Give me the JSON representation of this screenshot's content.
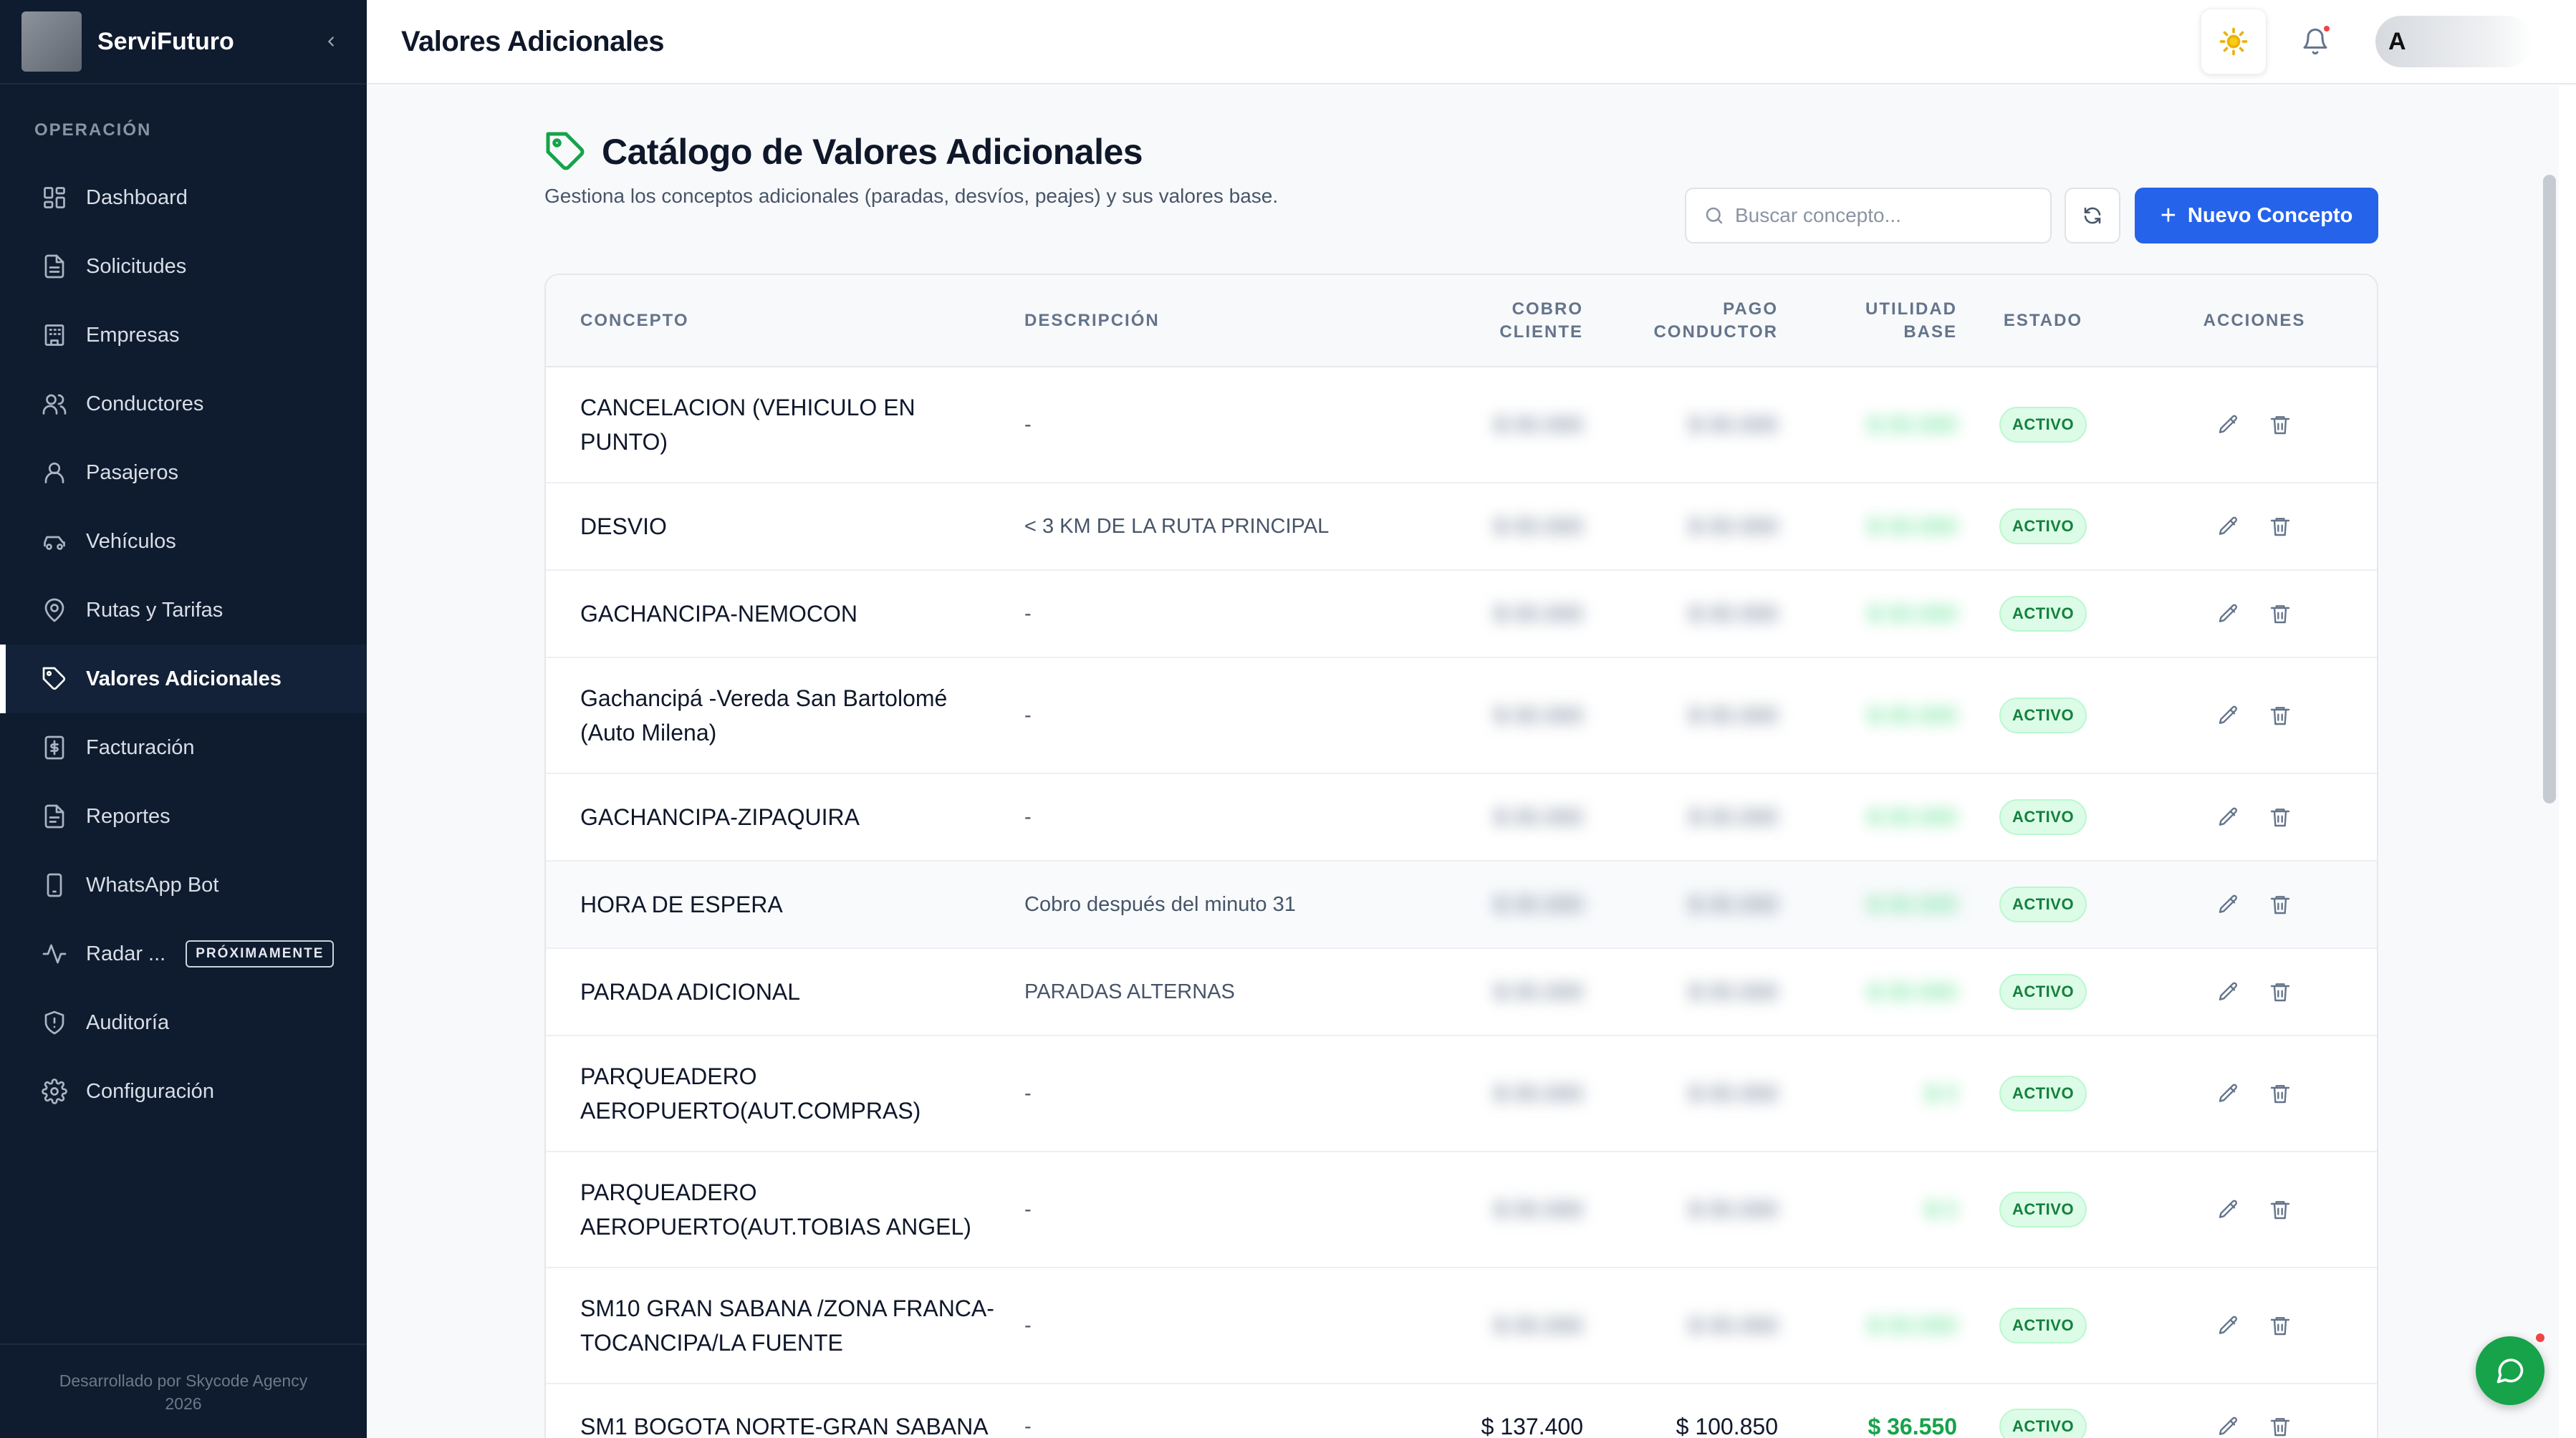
{
  "sidebar": {
    "brand": "ServiFuturo",
    "section_label": "OPERACIÓN",
    "items": [
      {
        "label": "Dashboard",
        "icon": "dashboard-icon"
      },
      {
        "label": "Solicitudes",
        "icon": "document-icon"
      },
      {
        "label": "Empresas",
        "icon": "building-icon"
      },
      {
        "label": "Conductores",
        "icon": "users-icon"
      },
      {
        "label": "Pasajeros",
        "icon": "user-icon"
      },
      {
        "label": "Vehículos",
        "icon": "car-icon"
      },
      {
        "label": "Rutas y Tarifas",
        "icon": "map-pin-icon"
      },
      {
        "label": "Valores Adicionales",
        "icon": "tag-icon",
        "active": true
      },
      {
        "label": "Facturación",
        "icon": "invoice-icon"
      },
      {
        "label": "Reportes",
        "icon": "report-icon"
      },
      {
        "label": "WhatsApp Bot",
        "icon": "phone-icon"
      },
      {
        "label": "Radar ...",
        "icon": "activity-icon",
        "badge": "PRÓXIMAMENTE"
      },
      {
        "label": "Auditoría",
        "icon": "shield-icon"
      },
      {
        "label": "Configuración",
        "icon": "gear-icon"
      }
    ],
    "footer_line1": "Desarrollado por Skycode Agency",
    "footer_line2": "2026"
  },
  "topbar": {
    "title": "Valores Adicionales",
    "avatar_initial": "A"
  },
  "page": {
    "title": "Catálogo de Valores Adicionales",
    "subtitle": "Gestiona los conceptos adicionales (paradas, desvíos, peajes) y sus valores base.",
    "search_placeholder": "Buscar concepto...",
    "new_button": "Nuevo Concepto"
  },
  "table": {
    "headers": {
      "concepto": "CONCEPTO",
      "descripcion": "DESCRIPCIÓN",
      "cobro_l1": "COBRO",
      "cobro_l2": "CLIENTE",
      "pago_l1": "PAGO",
      "pago_l2": "CONDUCTOR",
      "utilidad_l1": "UTILIDAD",
      "utilidad_l2": "BASE",
      "estado": "ESTADO",
      "acciones": "ACCIONES"
    },
    "rows": [
      {
        "concepto": "CANCELACION (VEHICULO EN PUNTO)",
        "descripcion": "-",
        "cobro": "$ 00.000",
        "pago": "$ 00.000",
        "utilidad": "$ 00.000",
        "estado": "ACTIVO",
        "blurred": true
      },
      {
        "concepto": "DESVIO",
        "descripcion": "< 3 KM DE LA RUTA PRINCIPAL",
        "cobro": "$ 00.000",
        "pago": "$ 00.000",
        "utilidad": "$ 00.000",
        "estado": "ACTIVO",
        "blurred": true
      },
      {
        "concepto": "GACHANCIPA-NEMOCON",
        "descripcion": "-",
        "cobro": "$ 00.000",
        "pago": "$ 00.000",
        "utilidad": "$ 00.000",
        "estado": "ACTIVO",
        "blurred": true
      },
      {
        "concepto": "Gachancipá -Vereda San Bartolomé (Auto Milena)",
        "descripcion": "-",
        "cobro": "$ 00.000",
        "pago": "$ 00.000",
        "utilidad": "$ 00.000",
        "estado": "ACTIVO",
        "blurred": true
      },
      {
        "concepto": "GACHANCIPA-ZIPAQUIRA",
        "descripcion": "-",
        "cobro": "$ 00.000",
        "pago": "$ 00.000",
        "utilidad": "$ 00.000",
        "estado": "ACTIVO",
        "blurred": true
      },
      {
        "concepto": "HORA DE ESPERA",
        "descripcion": "Cobro después del minuto 31",
        "cobro": "$ 00.000",
        "pago": "$ 00.000",
        "utilidad": "$ 00.000",
        "estado": "ACTIVO",
        "blurred": true,
        "highlight": true
      },
      {
        "concepto": "PARADA ADICIONAL",
        "descripcion": "PARADAS ALTERNAS",
        "cobro": "$ 00.000",
        "pago": "$ 00.000",
        "utilidad": "$ 00.000",
        "estado": "ACTIVO",
        "blurred": true
      },
      {
        "concepto": "PARQUEADERO AEROPUERTO(AUT.COMPRAS)",
        "descripcion": "-",
        "cobro": "$ 00.000",
        "pago": "$ 00.000",
        "utilidad": "$ 0",
        "estado": "ACTIVO",
        "blurred": true
      },
      {
        "concepto": "PARQUEADERO AEROPUERTO(AUT.TOBIAS ANGEL)",
        "descripcion": "-",
        "cobro": "$ 00.000",
        "pago": "$ 00.000",
        "utilidad": "$ 0",
        "estado": "ACTIVO",
        "blurred": true
      },
      {
        "concepto": "SM10 GRAN SABANA /ZONA FRANCA-TOCANCIPA/LA FUENTE",
        "descripcion": "-",
        "cobro": "$ 00.000",
        "pago": "$ 00.000",
        "utilidad": "$ 00.000",
        "estado": "ACTIVO",
        "blurred": true
      },
      {
        "concepto": "SM1 BOGOTA NORTE-GRAN SABANA",
        "descripcion": "-",
        "cobro": "$ 137.400",
        "pago": "$ 100.850",
        "utilidad": "$ 36.550",
        "estado": "ACTIVO",
        "blurred": false
      }
    ]
  },
  "colors": {
    "sidebar_bg": "#0f1b2e",
    "primary": "#2563eb",
    "success": "#16a34a",
    "status_bg": "#dcfce7"
  }
}
